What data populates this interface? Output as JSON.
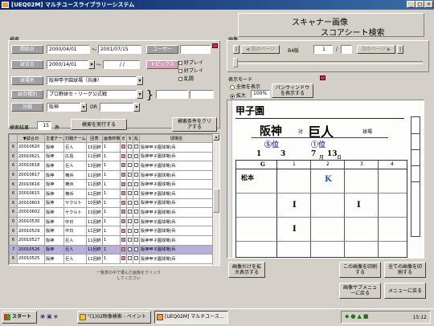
{
  "window": {
    "title": "[UEQ02M] マルチユースライブラリーシステム",
    "min": "_",
    "max": "□",
    "close": "×"
  },
  "header": {
    "line1": "スキャナー画像",
    "line2": "スコアシート検索"
  },
  "search": {
    "section_label": "検索",
    "start_date_label": "開始日",
    "start_date": "2000/04/01",
    "tilde": "〜",
    "end_date": "2001/07/15",
    "user_label": "ユーザー",
    "game_date_label": "試合日",
    "game_date": "2000/14/01",
    "game_date_end": "/ /",
    "topics_label": "トピックス",
    "checks": [
      "好プレイ",
      "好プレイ",
      "乱闘"
    ],
    "stadium_label": "球場名",
    "stadium": "阪神甲子園球場（兵庫）",
    "league_label": "試合種別",
    "league": "プロ野球セ・リーグ公式戦",
    "team_label": "対戦",
    "team1": "阪神",
    "or_label": "OR",
    "team2": "",
    "result_label": "検索結果",
    "result_count": "15",
    "result_unit": "件",
    "run_button": "検索を実行する",
    "clear_button": "検索条件をクリアする"
  },
  "table": {
    "headers": [
      "",
      "▼試合日",
      "主催チーム",
      "対戦チーム",
      "回表",
      "画像枠数",
      "8",
      "9",
      "乱",
      "球場名"
    ],
    "rows": [
      {
        "no": "6",
        "date": "20010620",
        "home": "阪神",
        "away": "巨人",
        "inn": "15回終",
        "frames": "1",
        "stadium": "阪神甲子園球場(兵"
      },
      {
        "no": "6",
        "date": "20010621",
        "home": "阪神",
        "away": "広島",
        "inn": "11回終",
        "frames": "1",
        "stadium": "阪神甲子園球場(兵"
      },
      {
        "no": "6",
        "date": "20010618",
        "home": "阪神",
        "away": "巨人",
        "inn": "13回終",
        "frames": "1",
        "stadium": "阪神甲子園球場(兵"
      },
      {
        "no": "6",
        "date": "20010617",
        "home": "阪神",
        "away": "横浜",
        "inn": "11回終",
        "frames": "1",
        "stadium": "阪神甲子園球場(兵"
      },
      {
        "no": "6",
        "date": "20010616",
        "home": "阪神",
        "away": "横浜",
        "inn": "11回終",
        "frames": "1",
        "stadium": "阪神甲子園球場(兵"
      },
      {
        "no": "6",
        "date": "20010615",
        "home": "阪神",
        "away": "横浜",
        "inn": "11回終",
        "frames": "1",
        "stadium": "阪神甲子園球場(兵"
      },
      {
        "no": "6",
        "date": "20010603",
        "home": "阪神",
        "away": "ヤクルト",
        "inn": "10回終",
        "frames": "1",
        "stadium": "阪神甲子園球場(兵"
      },
      {
        "no": "6",
        "date": "20010602",
        "home": "阪神",
        "away": "ヤクルト",
        "inn": "13回終",
        "frames": "1",
        "stadium": "阪神甲子園球場(兵"
      },
      {
        "no": "6",
        "date": "20010530",
        "home": "阪神",
        "away": "中日",
        "inn": "11回終",
        "frames": "1",
        "stadium": "阪神甲子園球場(兵"
      },
      {
        "no": "6",
        "date": "20010529",
        "home": "阪神",
        "away": "中日",
        "inn": "11回終",
        "frames": "1",
        "stadium": "阪神甲子園球場(兵"
      },
      {
        "no": "6",
        "date": "20010527",
        "home": "阪神",
        "away": "巨人",
        "inn": "11回終",
        "frames": "1",
        "stadium": "阪神甲子園球場(兵"
      },
      {
        "no": "7",
        "date": "20010526",
        "home": "阪神",
        "away": "巨人",
        "inn": "11回終",
        "frames": "1",
        "stadium": "阪神甲子園球場(兵"
      },
      {
        "no": "6",
        "date": "20010525",
        "home": "阪神",
        "away": "巨人",
        "inn": "11回終",
        "frames": "1",
        "stadium": "阪神甲子園球場(兵"
      }
    ],
    "footer_note": "一覧表の中で選んだ画像をクリックしてください"
  },
  "viewer": {
    "section_label": "画像",
    "prev_btn": "◀ 前のページ",
    "page_label": "B4版",
    "page_num": "1",
    "slash": "/",
    "next_btn": "次のページ ▶",
    "mode_label": "表示モード",
    "mode_full": "全体を表示",
    "mode_zoom": "拡大",
    "zoom": "100%",
    "pan_button": "パンウィンドウを表示する",
    "sheet": {
      "stadium": "甲子園",
      "home": "阪神",
      "vs": "対",
      "away": "巨人",
      "place": "球場",
      "pos1": "⑤位",
      "pos2": "①位",
      "score_a": "1",
      "score_b": "3",
      "score_c": "7",
      "score_d": "13",
      "month": "月",
      "day": "日",
      "col_g": "G",
      "n1": "1",
      "n2": "2",
      "n3": "3",
      "n4": "4",
      "n5": "5",
      "name": "松本"
    },
    "btn_zoom_only": "画像だけを拡大表示する",
    "btn_print": "この画像を印刷する",
    "btn_print_all": "全ての画像を印刷する"
  },
  "bottom": {
    "btn_image_menu": "画像サブメニューに戻る",
    "btn_main_menu": "メニューに戻る"
  },
  "taskbar": {
    "start": "スタート",
    "task1": "\"(1)02映像検索 - ペイント",
    "task2": "[UEQ02M] マルチユース...",
    "clock": "15:12"
  },
  "colors": {
    "title_start": "#0a246a",
    "title_end": "#3a6ea5",
    "selected_row": "#b8b0d8"
  }
}
